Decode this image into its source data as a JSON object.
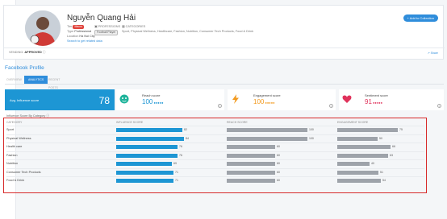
{
  "profile": {
    "name": "Nguyễn Quang Hải",
    "add_button": "+ Add to Collection",
    "fields": {
      "tier_label": "Tier",
      "tier_badge": "Macro",
      "type_label": "Type",
      "type_value": "Professional",
      "location_label": "Location",
      "location_value": "Ha Noi City",
      "link": "Search to get related data"
    },
    "profession_label": "PROFESSIONS",
    "profession_value": "Football Player",
    "categories_label": "CATEGORIES",
    "categories_value": "Sport, Physical Wellness, Healthcare, Fashion, Nutrition, Consumer Tech Products, Food & Drink",
    "vetting_label": "VENDING:",
    "vetting_value": "APPROVED",
    "share": "Share"
  },
  "section": {
    "title": "Facebook Profile",
    "tabs": [
      "OVERVIEW",
      "ANALYTICS",
      "RECENT POSTS"
    ],
    "active_tab": "ANALYTICS"
  },
  "kpis": {
    "influence_label": "Avg. Influence score",
    "influence_value": "78",
    "reach_label": "Reach score",
    "reach_value": "100",
    "engagement_label": "Engagement score",
    "engagement_value": "100",
    "sentiment_label": "Sentiment score",
    "sentiment_value": "91"
  },
  "table": {
    "caption": "Influence Score By Category",
    "headers": [
      "CATEGORY",
      "INFLUENCE SCORE",
      "REACH SCORE",
      "ENGAGEMENT SCORE"
    ],
    "rows": [
      {
        "category": "Sport",
        "influence": 82,
        "reach": 100,
        "engagement": 75
      },
      {
        "category": "Physical Wellness",
        "influence": 84,
        "reach": 100,
        "engagement": 50
      },
      {
        "category": "Health care",
        "influence": 76,
        "reach": 60,
        "engagement": 66
      },
      {
        "category": "Fashion",
        "influence": 76,
        "reach": 60,
        "engagement": 63
      },
      {
        "category": "Nutrition",
        "influence": 69,
        "reach": 60,
        "engagement": 40
      },
      {
        "category": "Consumer Tech Products",
        "influence": 71,
        "reach": 60,
        "engagement": 51
      },
      {
        "category": "Food & Drink",
        "influence": 71,
        "reach": 60,
        "engagement": 54
      }
    ]
  },
  "colors": {
    "accent": "#1d96d4",
    "bar_influence": "#1d96d4",
    "bar_other": "#9ea3aa",
    "highlight": "#d72a2a"
  }
}
